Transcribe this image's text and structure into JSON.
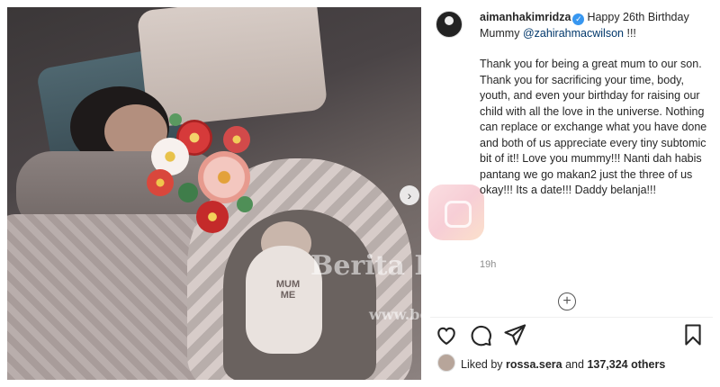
{
  "post": {
    "username": "aimanhakimridza",
    "caption_start": "Happy 26th Birthday Mummy",
    "mention": "@zahirahmacwilson",
    "caption_end": "!!!",
    "paragraph": "Thank you for being a great mum to our son. Thank you for sacrificing your time, body, youth, and even your birthday for raising our child with all the love in the universe. Nothing can replace or exchange what you have done and both of us appreciate every tiny subtomic bit of it!! Love you mummy!!! Nanti dah habis pantang we go makan2 just the three of us okay!!! Its a date!!! Daddy belanja!!!",
    "time": "19h",
    "liked_by_prefix": "Liked by",
    "liked_by_user": "rossa.sera",
    "liked_by_and": "and",
    "liked_count": "137,324 others"
  },
  "photo": {
    "onesie_text": "MUM\nME",
    "watermark_1": "Berita Kopak",
    "watermark_2": "www.beritakopak.com"
  },
  "icons": {
    "verified": "verified-badge-icon",
    "like": "heart-icon",
    "comment": "comment-icon",
    "share": "paper-plane-icon",
    "save": "bookmark-icon",
    "add_comment": "plus-circle-icon",
    "next": "chevron-right-icon"
  },
  "colors": {
    "verified": "#3897f0",
    "mention": "#00376b",
    "muted": "#8e8e8e"
  }
}
